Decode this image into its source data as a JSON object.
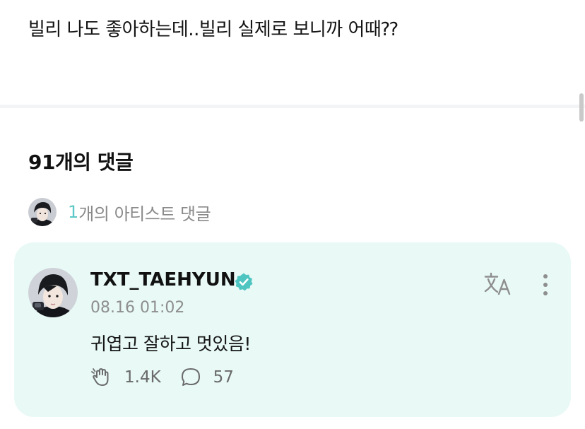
{
  "post": {
    "text": "빌리 나도 좋아하는데..빌리 실제로 보니까 어때⁇"
  },
  "comments_section": {
    "title": "91개의 댓글",
    "artist_comments": {
      "count": "1",
      "label": "개의 아티스트 댓글"
    }
  },
  "artist_comment": {
    "username": "TXT_TAEHYUN",
    "verified": true,
    "timestamp": "08.16 01:02",
    "text": "귀엽고 잘하고 멋있음!",
    "likes": "1.4K",
    "replies": "57"
  },
  "icons": {
    "verified": "verified-badge-icon",
    "translate": "translate-icon",
    "more": "more-vertical-icon",
    "like": "cheer-hand-icon",
    "reply": "comment-bubble-icon"
  },
  "colors": {
    "accent": "#5ec8c8",
    "card_background": "#e8f9f6",
    "verified_badge": "#4ec5c1",
    "muted_text": "#8e8e8e"
  }
}
